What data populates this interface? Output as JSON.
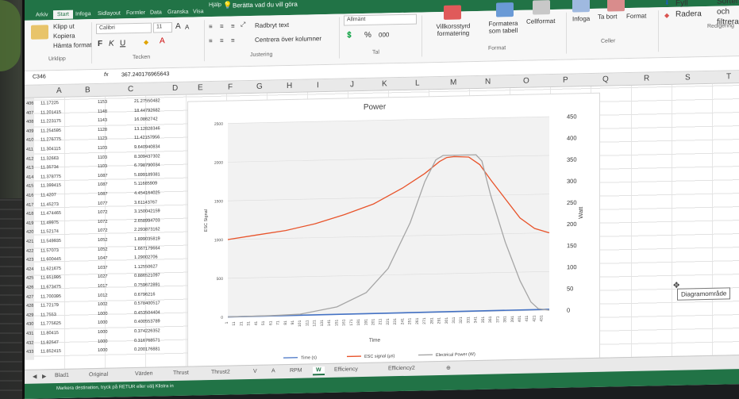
{
  "ribbon": {
    "tabs": [
      "Arkiv",
      "Start",
      "Infoga",
      "Sidlayout",
      "Formler",
      "Data",
      "Granska",
      "Visa",
      "Hjälp"
    ],
    "tell_me": "Berätta vad du vill göra",
    "clipboard": {
      "cut": "Klipp ut",
      "copy": "Kopiera",
      "paint": "Hämta format",
      "group": "Urklipp"
    },
    "font": {
      "name": "Calibri",
      "size": "11",
      "grow": "A",
      "shrink": "A",
      "bold": "F",
      "italic": "K",
      "underline": "U",
      "group": "Tecken"
    },
    "alignment": {
      "wrap": "Radbryt text",
      "merge": "Centrera över kolumner",
      "group": "Justering"
    },
    "number": {
      "format": "Allmänt",
      "percent": "%",
      "comma": "000",
      "group": "Tal"
    },
    "styles": {
      "conditional": "Villkorsstyrd formatering",
      "table": "Formatera som tabell",
      "cell": "Cellformat",
      "group": "Format"
    },
    "cells": {
      "insert": "Infoga",
      "delete": "Ta bort",
      "format": "Format",
      "group": "Celler"
    },
    "editing": {
      "fill": "Fyll",
      "clear": "Radera",
      "sort": "Sortera och filtrera",
      "group": "Redigering"
    }
  },
  "formula_bar": {
    "cell": "C346",
    "fx": "fx",
    "value": "367.240176965643"
  },
  "columns": [
    "A",
    "B",
    "C",
    "D",
    "E",
    "F",
    "G",
    "H",
    "I",
    "J",
    "K",
    "L",
    "M",
    "N",
    "O",
    "P",
    "Q",
    "R",
    "S",
    "T"
  ],
  "rows": [
    [
      "406",
      "11.17225",
      "1153",
      "21.27550482"
    ],
    [
      "407",
      "11.201415",
      "1148",
      "18.44792682"
    ],
    [
      "408",
      "11.223175",
      "1143",
      "16.0862742"
    ],
    [
      "409",
      "11.254595",
      "1128",
      "13.12828346"
    ],
    [
      "410",
      "11.276775",
      "1123",
      "11.42157956"
    ],
    [
      "411",
      "11.304115",
      "1103",
      "9.640940834"
    ],
    [
      "412",
      "11.32663",
      "1103",
      "8.309437302"
    ],
    [
      "413",
      "11.35734",
      "1103",
      "6.798790034"
    ],
    [
      "414",
      "11.378775",
      "1087",
      "5.899189381"
    ],
    [
      "415",
      "11.399415",
      "1087",
      "5.11685909"
    ],
    [
      "416",
      "11.4207",
      "1087",
      "4.454164025"
    ],
    [
      "417",
      "11.45273",
      "1077",
      "3.61143767"
    ],
    [
      "418",
      "11.474465",
      "1072",
      "3.150042159"
    ],
    [
      "419",
      "11.49975",
      "1072",
      "2.658994703"
    ],
    [
      "420",
      "11.52174",
      "1072",
      "2.293873162"
    ],
    [
      "421",
      "11.549935",
      "1052",
      "1.899035819"
    ],
    [
      "422",
      "11.57073",
      "1052",
      "1.667179664"
    ],
    [
      "423",
      "11.600445",
      "1047",
      "1.29002706"
    ],
    [
      "424",
      "11.621675",
      "1037",
      "1.12550627"
    ],
    [
      "425",
      "11.651995",
      "1027",
      "0.886521097"
    ],
    [
      "426",
      "11.673475",
      "1017",
      "0.759672891"
    ],
    [
      "427",
      "11.700395",
      "1012",
      "0.6796216"
    ],
    [
      "428",
      "11.72179",
      "1002",
      "0.578400517"
    ],
    [
      "429",
      "11.7553",
      "1000",
      "0.453504404"
    ],
    [
      "430",
      "11.775625",
      "1000",
      "0.400553789"
    ],
    [
      "431",
      "11.80415",
      "1000",
      "0.374226352"
    ],
    [
      "432",
      "11.82547",
      "1000",
      "0.316768571"
    ],
    [
      "433",
      "11.852415",
      "1000",
      "0.200176881"
    ]
  ],
  "chart_data": {
    "type": "line",
    "title": "Power",
    "xlabel": "Time",
    "ylabel_left": "ESC Signal",
    "ylabel_right": "Watt",
    "y_left_ticks": [
      0,
      500,
      1000,
      1500,
      2000,
      2500
    ],
    "y_left_lim": [
      0,
      2500
    ],
    "y_right_ticks": [
      0,
      50,
      100,
      150,
      200,
      250,
      300,
      350,
      400,
      450
    ],
    "y_right_lim": [
      0,
      450
    ],
    "x_ticks": [
      "1",
      "11",
      "21",
      "31",
      "41",
      "51",
      "61",
      "71",
      "81",
      "91",
      "101",
      "111",
      "121",
      "131",
      "141",
      "151",
      "161",
      "171",
      "181",
      "191",
      "201",
      "211",
      "221",
      "231",
      "241",
      "251",
      "261",
      "271",
      "281",
      "291",
      "301",
      "311",
      "321",
      "331",
      "341",
      "351",
      "361",
      "371",
      "381",
      "391",
      "401",
      "411",
      "421",
      "431"
    ],
    "x_max": 440,
    "legend": [
      "Time (s)",
      "ESC signal (µs)",
      "Electrical Power (W)"
    ],
    "legend_position": "bottom",
    "colors": {
      "time": "#4472c4",
      "esc": "#e8532a",
      "power": "#a5a5a5"
    },
    "series": [
      {
        "name": "Time (s)",
        "axis": "left",
        "x": [
          1,
          440
        ],
        "y": [
          0,
          12
        ]
      },
      {
        "name": "ESC signal (µs)",
        "axis": "left",
        "x": [
          1,
          40,
          80,
          120,
          160,
          200,
          240,
          270,
          290,
          300,
          310,
          330,
          345,
          360,
          380,
          400,
          420,
          440
        ],
        "y": [
          1000,
          1050,
          1100,
          1180,
          1290,
          1420,
          1620,
          1800,
          1950,
          2000,
          2010,
          2000,
          1900,
          1700,
          1450,
          1200,
          1060,
          1000
        ]
      },
      {
        "name": "Electrical Power (W)",
        "axis": "right",
        "x": [
          1,
          60,
          100,
          150,
          190,
          220,
          250,
          270,
          285,
          295,
          340,
          348,
          360,
          380,
          400,
          415,
          425,
          440
        ],
        "y": [
          0,
          1,
          3,
          18,
          50,
          105,
          210,
          305,
          355,
          365,
          365,
          350,
          270,
          160,
          70,
          20,
          4,
          0
        ]
      }
    ]
  },
  "chart_area_tooltip": "Diagramområde",
  "sheet_tabs": [
    "Blad1",
    "Original",
    "Värden",
    "Thrust",
    "Thrust2",
    "V",
    "A",
    "RPM",
    "W",
    "Efficiency",
    "Efficiency2"
  ],
  "active_sheet": "W",
  "status_text": "Markera destination, tryck på RETUR eller välj Klistra in",
  "colors": {
    "excel_green": "#217346"
  }
}
